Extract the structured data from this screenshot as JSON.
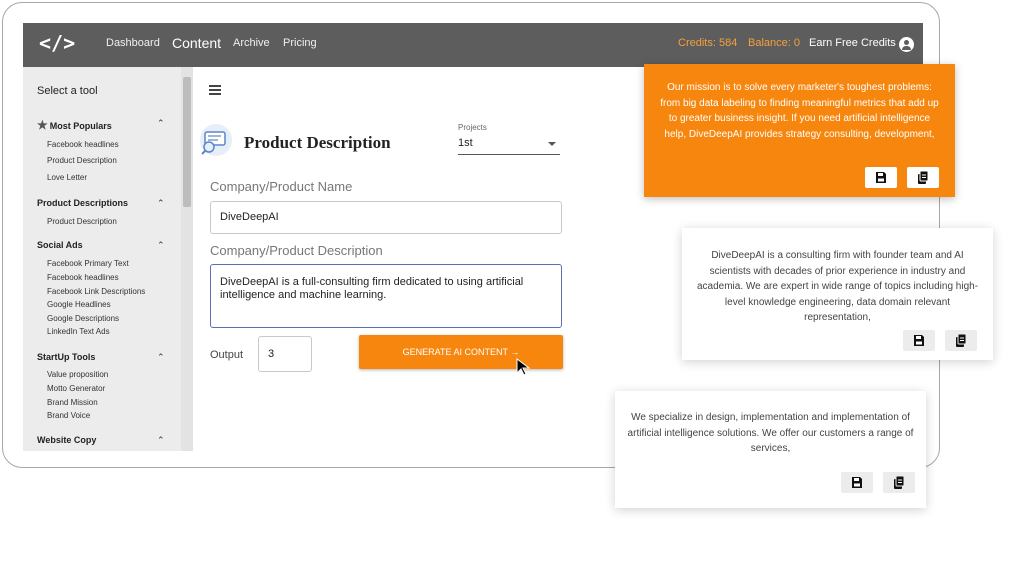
{
  "header": {
    "logo": "</>",
    "nav": [
      "Dashboard",
      "Content",
      "Archive",
      "Pricing"
    ],
    "active_nav": "Content",
    "credits": "Credits: 584",
    "balance": "Balance: 0",
    "earn": "Earn Free Credits"
  },
  "sidebar": {
    "title": "Select a tool",
    "groups": [
      {
        "label": "Most Populars",
        "items": [
          "Facebook headlines",
          "Product Description",
          "Love Letter"
        ]
      },
      {
        "label": "Product Descriptions",
        "items": [
          "Product Description"
        ]
      },
      {
        "label": "Social Ads",
        "items": [
          "Facebook Primary Text",
          "Facebook headlines",
          "Facebook Link Descriptions",
          "Google Headlines",
          "Google Descriptions",
          "LinkedIn Text Ads"
        ]
      },
      {
        "label": "StartUp Tools",
        "items": [
          "Value proposition",
          "Motto Generator",
          "Brand Mission",
          "Brand Voice"
        ]
      },
      {
        "label": "Website Copy",
        "items": []
      }
    ]
  },
  "main": {
    "title": "Product Description",
    "projects_label": "Projects",
    "projects_value": "1st",
    "name_label": "Company/Product Name",
    "name_value": "DiveDeepAI",
    "desc_label": "Company/Product Description",
    "desc_value": "DiveDeepAI is a full-consulting firm dedicated to using artificial intelligence and machine learning.",
    "output_label": "Output",
    "output_value": "3",
    "generate_label": "GENERATE AI CONTENT →"
  },
  "results": [
    {
      "text": "Our mission is to solve every marketer's toughest problems: from big data labeling to finding meaningful metrics that add up to greater business insight. If you need artificial intelligence help, DiveDeepAI provides strategy consulting, development,"
    },
    {
      "text": "DiveDeepAI is a consulting firm with founder team and AI scientists with decades of prior experience in industry and academia. We are expert in wide range of topics including high-level knowledge engineering, data domain relevant representation,"
    },
    {
      "text": "We specialize in design, implementation and implementation of artificial intelligence solutions. We offer our customers a range of services,"
    }
  ],
  "colors": {
    "accent": "#f7860e",
    "topbar": "#5d5d5d",
    "sidebar": "#ececec"
  },
  "icons": {
    "save": "save-icon",
    "copy": "copy-icon",
    "user": "user-icon",
    "menu": "hamburger-icon"
  }
}
